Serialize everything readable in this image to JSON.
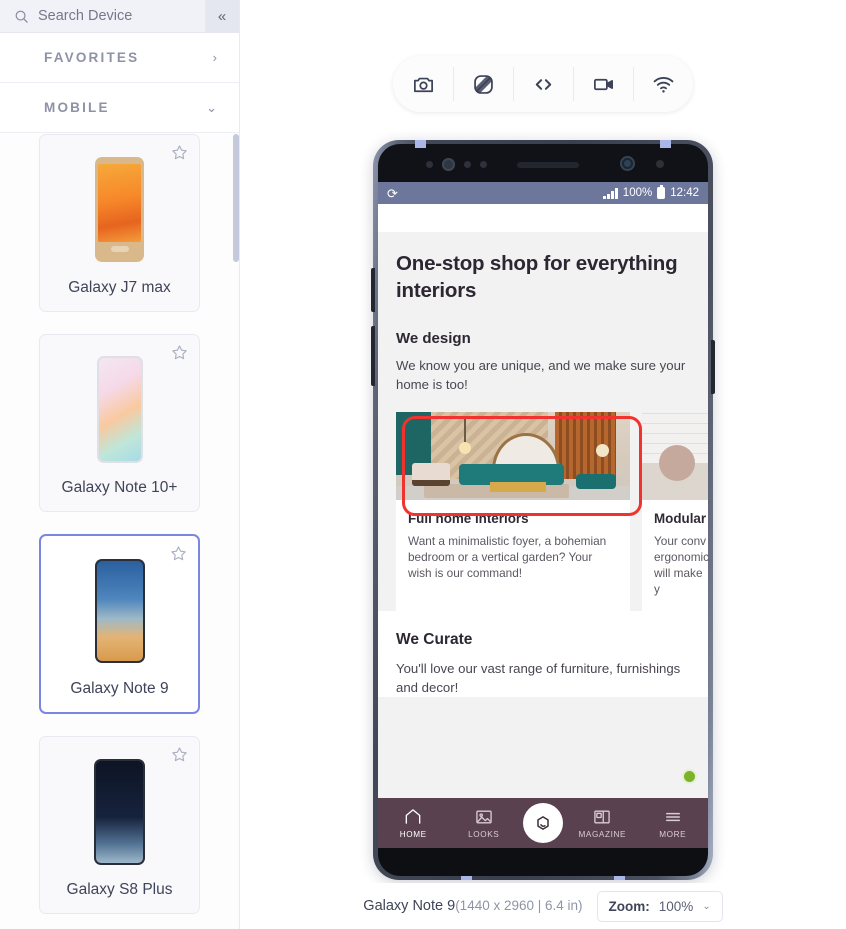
{
  "sidebar": {
    "search": {
      "placeholder": "Search Device",
      "value": "",
      "icon": "search-icon"
    },
    "collapse_label": "«",
    "sections": [
      {
        "title": "FAVORITES",
        "chevron": "›",
        "expanded": false
      },
      {
        "title": "MOBILE",
        "chevron": "⌄",
        "expanded": true
      }
    ],
    "devices": [
      {
        "name": "Galaxy J7 max",
        "selected": false,
        "favorite": false
      },
      {
        "name": "Galaxy Note 10+",
        "selected": false,
        "favorite": false
      },
      {
        "name": "Galaxy Note 9",
        "selected": true,
        "favorite": false
      },
      {
        "name": "Galaxy S8 Plus",
        "selected": false,
        "favorite": false
      }
    ]
  },
  "toolbar": {
    "buttons": [
      {
        "name": "screenshot-icon",
        "title": "Screenshot"
      },
      {
        "name": "rotate-icon",
        "title": "Rotate"
      },
      {
        "name": "code-icon",
        "title": "Inspect"
      },
      {
        "name": "record-icon",
        "title": "Record"
      },
      {
        "name": "wifi-icon",
        "title": "Throttle"
      }
    ]
  },
  "phone": {
    "statusbar": {
      "signal": "signal-icon",
      "battery": "100%",
      "time": "12:42"
    },
    "page": {
      "hero_title": "One-stop shop for everything interiors",
      "design_heading": "We design",
      "design_text": "We know you are unique, and we make sure your home is too!",
      "cards": [
        {
          "title": "Full home interiors",
          "text": "Want a minimalistic foyer, a bohemian bedroom or a vertical garden? Your wish is our command!",
          "image": "living-room-teal-sofa"
        },
        {
          "title": "Modular",
          "text": "Your conv ergonomic will make y",
          "image": "kitchen-counter"
        }
      ],
      "curate_heading": "We Curate",
      "curate_text": "You'll love our vast range of furniture, furnishings and decor!"
    },
    "bottom_nav": [
      {
        "label": "HOME",
        "icon": "home-icon",
        "active": true
      },
      {
        "label": "LOOKS",
        "icon": "image-icon",
        "active": false
      },
      {
        "label": "",
        "icon": "brand-logo-icon",
        "active": false
      },
      {
        "label": "MAGAZINE",
        "icon": "magazine-icon",
        "active": false
      },
      {
        "label": "MORE",
        "icon": "menu-icon",
        "active": false
      }
    ]
  },
  "footer": {
    "device_name": "Galaxy Note 9",
    "device_spec": "(1440 x 2960 | 6.4 in)",
    "zoom_label": "Zoom:",
    "zoom_value": "100%",
    "zoom_chevron": "⌄"
  },
  "colors": {
    "accent": "#7b86e0",
    "highlight": "#f0332e",
    "phone_nav": "#5a4150",
    "statusbar": "#6d779c"
  }
}
